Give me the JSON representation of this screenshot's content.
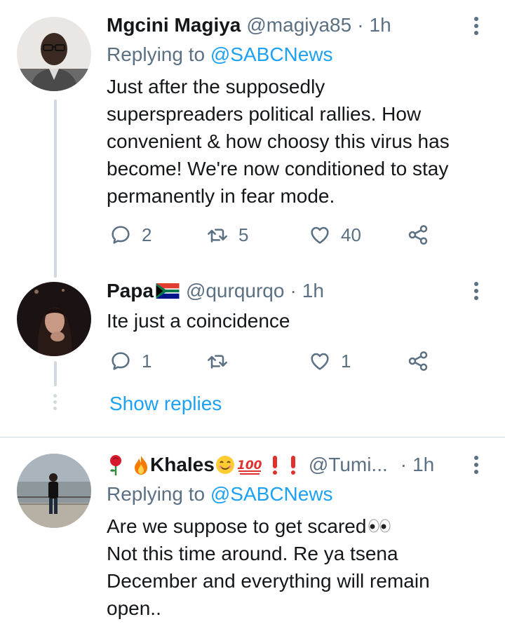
{
  "tweets": [
    {
      "name": "Mgcini Magiya",
      "handle": "@magiya85",
      "time": "1h",
      "replying_prefix": "Replying to",
      "replying_to": "@SABCNews",
      "lines": [
        "Just after the supposedly",
        "superspreaders political rallies. How",
        "convenient & how choosy this virus has",
        "become! We're now conditioned to stay",
        "permanently in fear mode."
      ],
      "reply_count": "2",
      "retweet_count": "5",
      "like_count": "40"
    },
    {
      "name": "Papa",
      "handle": "@qurqurqo",
      "time": "1h",
      "lines": [
        "Ite just a coincidence"
      ],
      "reply_count": "1",
      "retweet_count": "",
      "like_count": "1"
    },
    {
      "name": "Khales",
      "handle": "@Tumi...",
      "time": "1h",
      "replying_prefix": "Replying to",
      "replying_to": "@SABCNews",
      "lines": [
        "Are we suppose to get scared",
        "Not this time around. Re ya tsena",
        "December and everything will remain",
        "open.."
      ]
    }
  ],
  "show_replies": "Show replies",
  "separator": "·",
  "colors": {
    "text": "#14171a",
    "secondary": "#5b7083",
    "link": "#1da1f2",
    "line": "#cfd9de"
  },
  "icons": [
    "reply-icon",
    "retweet-icon",
    "like-icon",
    "share-icon",
    "more-icon",
    "flag-za-icon",
    "rose-icon",
    "fire-icon",
    "smile-icon",
    "hundred-icon",
    "exclamation-icon",
    "eyes-icon"
  ]
}
